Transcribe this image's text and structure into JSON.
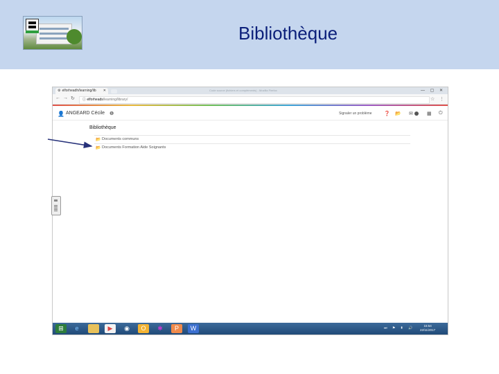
{
  "slide": {
    "title": "Bibliothèque"
  },
  "browser": {
    "tab_label": "elforheadh/learning/lib",
    "window_title": "Code source (fichiers et compléments) - Mozilla Firefox",
    "url_host": "elforheads",
    "url_path": "/learning/library/",
    "url_lock": "ⓘ",
    "star_icon": "☆",
    "menu_icon": "⋮",
    "controls": "— ▢ ✕"
  },
  "user": {
    "name": "ANGEARD Cécile",
    "info_icon": "❶",
    "report_label": "Signaler un problème"
  },
  "library": {
    "heading": "Bibliothèque",
    "folders": [
      {
        "label": "Documents communs"
      },
      {
        "label": "Documents Formation Aide Soignants"
      }
    ]
  },
  "taskbar": {
    "clock_time": "15:54",
    "clock_date": "22/11/2017",
    "tray": "⏭ ⚑ ▮ 🔊"
  },
  "colors": {
    "banner": "#c5d6ee",
    "title": "#0b1f7a",
    "arrow": "#27327a",
    "taskbar": "#204a78"
  }
}
